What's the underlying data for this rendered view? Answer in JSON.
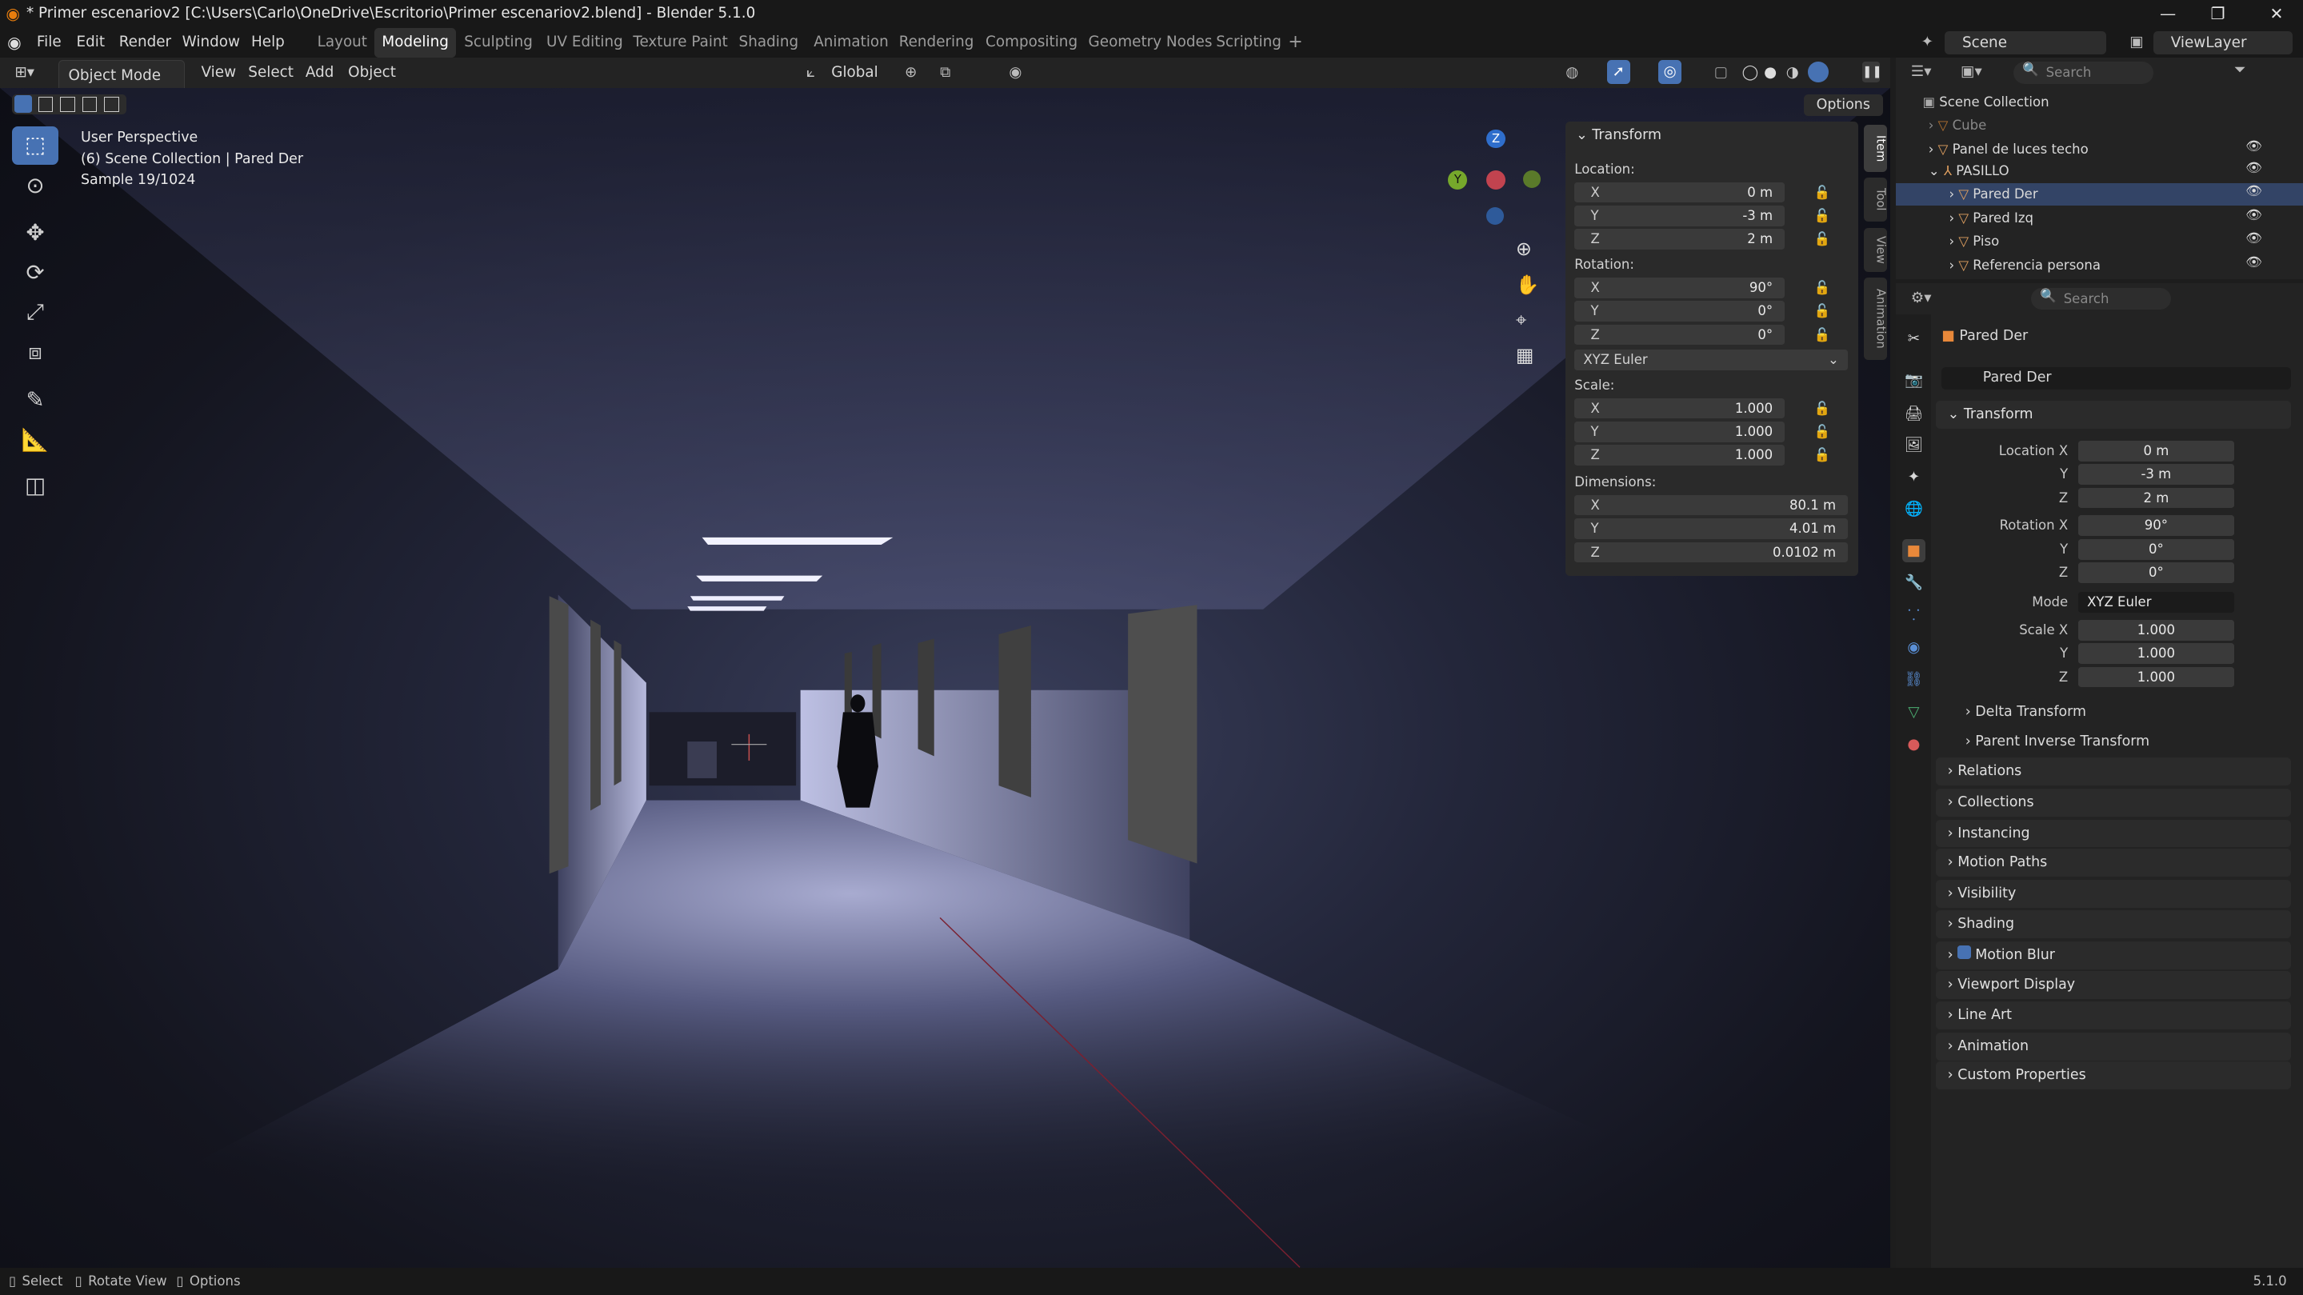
{
  "window": {
    "title": "* Primer escenariov2 [C:\\Users\\Carlo\\OneDrive\\Escritorio\\Primer escenariov2.blend] - Blender 5.1.0"
  },
  "menu": [
    "File",
    "Edit",
    "Render",
    "Window",
    "Help"
  ],
  "workspaces": [
    "Layout",
    "Modeling",
    "Sculpting",
    "UV Editing",
    "Texture Paint",
    "Shading",
    "Animation",
    "Rendering",
    "Compositing",
    "Geometry Nodes",
    "Scripting"
  ],
  "active_workspace": "Modeling",
  "scene": {
    "label": "Scene",
    "viewlayer": "ViewLayer"
  },
  "header": {
    "mode": "Object Mode",
    "view": "View",
    "select": "Select",
    "add": "Add",
    "object": "Object",
    "orientation": "Global",
    "options": "Options"
  },
  "overlay": {
    "line1": "User Perspective",
    "line2": "(6) Scene Collection | Pared Der",
    "line3": "Sample 19/1024"
  },
  "npanel": {
    "title": "Transform",
    "location_label": "Location:",
    "rotation_label": "Rotation:",
    "scale_label": "Scale:",
    "dimensions_label": "Dimensions:",
    "euler": "XYZ Euler",
    "location": {
      "x": "0 m",
      "y": "-3 m",
      "z": "2 m"
    },
    "rotation": {
      "x": "90°",
      "y": "0°",
      "z": "0°"
    },
    "scale": {
      "x": "1.000",
      "y": "1.000",
      "z": "1.000"
    },
    "dimensions": {
      "x": "80.1 m",
      "y": "4.01 m",
      "z": "0.0102 m"
    },
    "axes": {
      "x": "X",
      "y": "Y",
      "z": "Z"
    }
  },
  "sidetabs": [
    "Item",
    "Tool",
    "View",
    "Animation"
  ],
  "outliner": {
    "search": "Search",
    "root": "Scene Collection",
    "items": [
      {
        "name": "Cube"
      },
      {
        "name": "Panel de luces techo"
      },
      {
        "name": "PASILLO"
      },
      {
        "name": "Pared Der"
      },
      {
        "name": "Pared Izq"
      },
      {
        "name": "Piso"
      },
      {
        "name": "Referencia persona"
      }
    ]
  },
  "properties": {
    "search": "Search",
    "object_name": "Pared Der",
    "data_name": "Pared Der",
    "transform": "Transform",
    "location_x_label": "Location X",
    "rotation_x_label": "Rotation X",
    "scale_x_label": "Scale X",
    "y": "Y",
    "z": "Z",
    "mode_label": "Mode",
    "mode_value": "XYZ Euler",
    "loc": {
      "x": "0 m",
      "y": "-3 m",
      "z": "2 m"
    },
    "rot": {
      "x": "90°",
      "y": "0°",
      "z": "0°"
    },
    "scl": {
      "x": "1.000",
      "y": "1.000",
      "z": "1.000"
    },
    "subpanels": [
      "Delta Transform",
      "Parent Inverse Transform"
    ],
    "panels": [
      "Relations",
      "Collections",
      "Instancing",
      "Motion Paths",
      "Visibility",
      "Shading",
      "Motion Blur",
      "Viewport Display",
      "Line Art",
      "Animation",
      "Custom Properties"
    ]
  },
  "status": {
    "select": "Select",
    "rotate": "Rotate View",
    "options": "Options",
    "version": "5.1.0"
  }
}
